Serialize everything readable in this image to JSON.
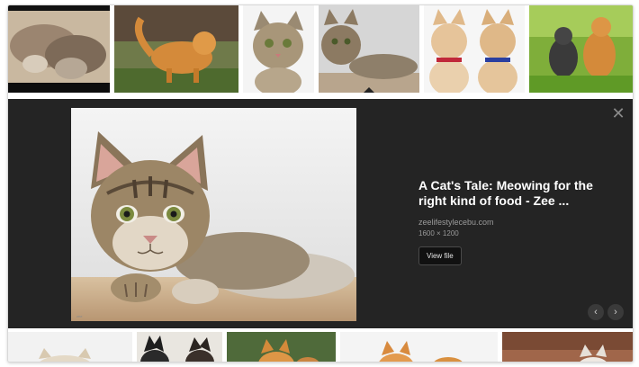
{
  "thumbnails": [
    {
      "alt": "Kittens sleeping"
    },
    {
      "alt": "Orange kitten walking in garden"
    },
    {
      "alt": "Tabby kitten portrait"
    },
    {
      "alt": "Tabby kitten lying down"
    },
    {
      "alt": "Two kittens with collars"
    },
    {
      "alt": "Two kittens in grass"
    }
  ],
  "bottom_thumbnails": [
    {
      "alt": "White kitten"
    },
    {
      "alt": "Black kittens"
    },
    {
      "alt": "Orange kittens"
    },
    {
      "alt": "Ginger kittens"
    },
    {
      "alt": "Brown kitten"
    }
  ],
  "panel": {
    "title": "A Cat's Tale: Meowing for the right kind of food - Zee ...",
    "source": "zeelifestylecebu.com",
    "dimensions": "1600 × 1200",
    "view_file_label": "View file",
    "close_symbol": "✕",
    "prev_symbol": "‹",
    "next_symbol": "›"
  },
  "colors": {
    "panel_bg": "#242424",
    "title": "#ffffff",
    "meta": "#9a9a9a"
  }
}
